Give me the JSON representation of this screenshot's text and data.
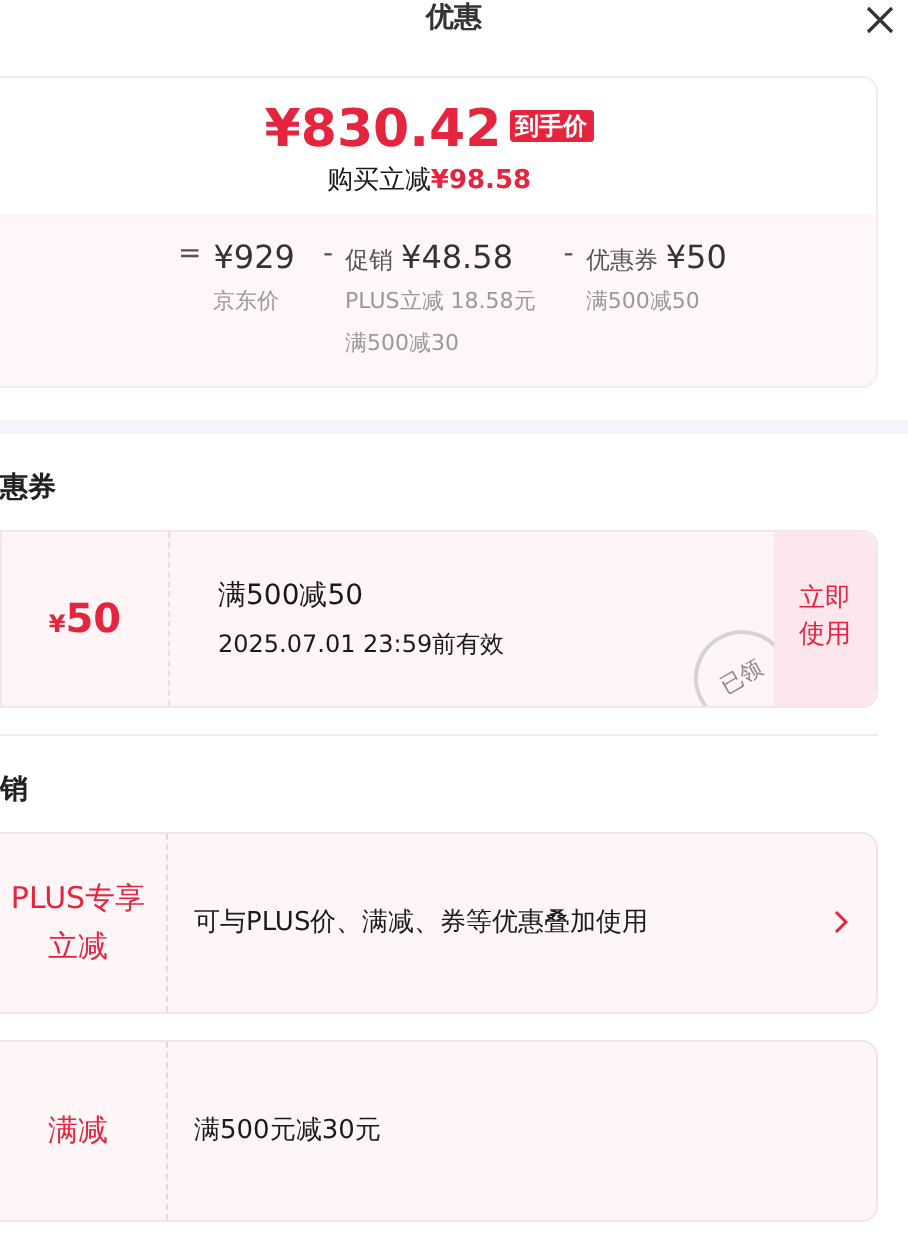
{
  "title": "优惠",
  "summary": {
    "final_price": "¥830.42",
    "final_tag": "到手价",
    "saving_label": "购买立减",
    "saving_amount": "¥98.58",
    "terms": [
      {
        "operator": "=",
        "amount": "¥929",
        "notes": [
          "京东价"
        ]
      },
      {
        "operator": "-",
        "label": "促销",
        "amount": "¥48.58",
        "notes": [
          "PLUS立减 18.58元",
          "满500减30"
        ]
      },
      {
        "operator": "-",
        "label": "优惠券",
        "amount": "¥50",
        "notes": [
          "满500减50"
        ]
      }
    ]
  },
  "coupon_section": {
    "heading": "惠券",
    "coupons": [
      {
        "currency": "¥",
        "value": "50",
        "condition": "满500减50",
        "validity": "2025.07.01 23:59前有效",
        "claimed": true,
        "stamp": "已领",
        "action": "立即使用"
      }
    ]
  },
  "promo_section": {
    "heading": "销",
    "promotions": [
      {
        "tag": "PLUS专享立减",
        "text": "可与PLUS价、满减、券等优惠叠加使用",
        "has_detail": true
      },
      {
        "tag": "满减",
        "text": "满500元减30元",
        "has_detail": false
      }
    ]
  }
}
